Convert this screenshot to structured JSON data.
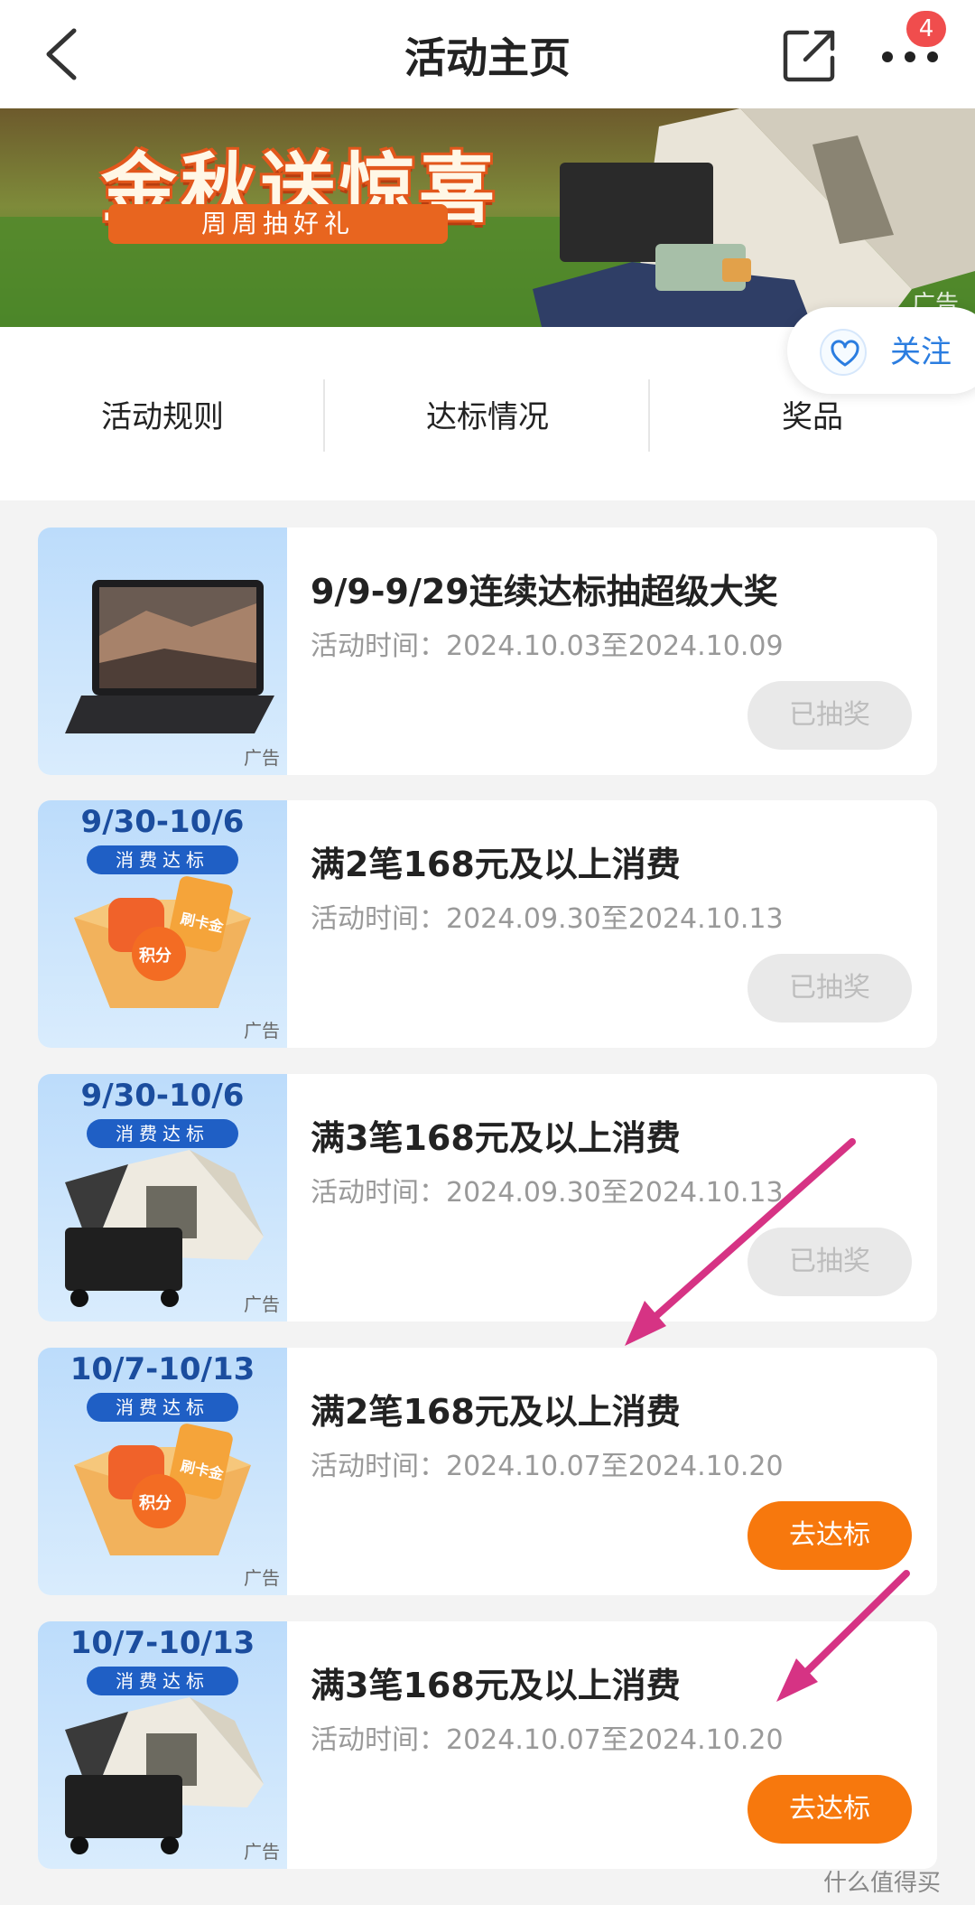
{
  "topbar": {
    "title": "活动主页",
    "badge": "4"
  },
  "banner": {
    "headline": "金秋送惊喜",
    "sub": "周周抽好礼",
    "ad": "广告"
  },
  "follow": {
    "label": "关注"
  },
  "tabs": [
    {
      "label": "活动规则"
    },
    {
      "label": "达标情况"
    },
    {
      "label": "奖品"
    }
  ],
  "cards": [
    {
      "title": "9/9-9/29连续达标抽超级大奖",
      "time": "活动时间：2024.10.03至2024.10.09",
      "button": "已抽奖",
      "ad": "广告"
    },
    {
      "title": "满2笔168元及以上消费",
      "time": "活动时间：2024.09.30至2024.10.13",
      "button": "已抽奖",
      "ad": "广告",
      "thumb_range": "9/30-10/6",
      "thumb_pill": "消费达标",
      "coin_label": "积分",
      "ticket_label": "刷卡金"
    },
    {
      "title": "满3笔168元及以上消费",
      "time": "活动时间：2024.09.30至2024.10.13",
      "button": "已抽奖",
      "ad": "广告",
      "thumb_range": "9/30-10/6",
      "thumb_pill": "消费达标"
    },
    {
      "title": "满2笔168元及以上消费",
      "time": "活动时间：2024.10.07至2024.10.20",
      "button": "去达标",
      "ad": "广告",
      "thumb_range": "10/7-10/13",
      "thumb_pill": "消费达标",
      "coin_label": "积分",
      "ticket_label": "刷卡金"
    },
    {
      "title": "满3笔168元及以上消费",
      "time": "活动时间：2024.10.07至2024.10.20",
      "button": "去达标",
      "ad": "广告",
      "thumb_range": "10/7-10/13",
      "thumb_pill": "消费达标"
    }
  ],
  "watermark": "什么值得买",
  "colors": {
    "accent_orange": "#f7780d",
    "annotation_arrow": "#d63384",
    "follow_blue": "#2b7de0"
  },
  "icons": [
    "back-arrow-icon",
    "share-icon",
    "more-dots-icon",
    "heart-icon"
  ]
}
